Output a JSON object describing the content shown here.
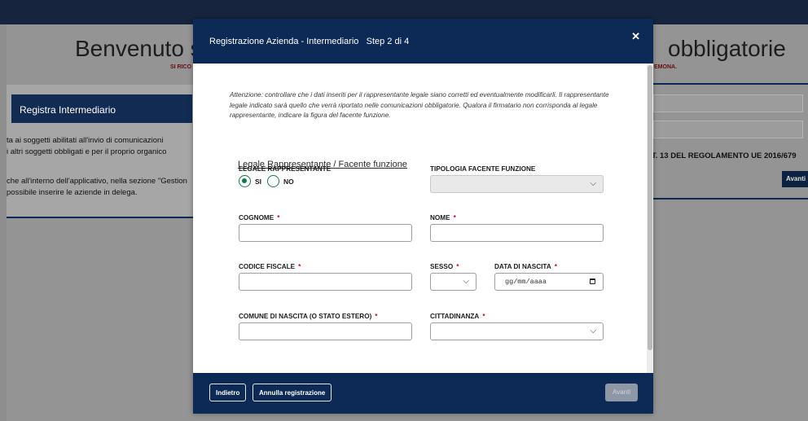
{
  "background": {
    "title_left": "Benvenuto s",
    "title_right": "obbligatorie",
    "subtitle_left": "SI RICO",
    "subtitle_right": "EMONA.",
    "card_header": "Registra Intermediario",
    "card_lines": [
      "ta ai soggetti abilitati all'invio di comunicazioni",
      "i altri soggetti obbligati e per il proprio organico",
      "",
      "che all'interno dell'applicativo, nella sezione \"Gestion",
      "possibile inserire le aziende in delega."
    ],
    "right_text": "T. 13 DEL REGOLAMENTO UE 2016/679",
    "right_button": "Avanti"
  },
  "modal": {
    "title": "Registrazione Azienda - Intermediario",
    "step": "Step 2 di 4",
    "close_icon": "close-icon",
    "warning": "Attenzione: controllare che i dati inseriti per il rappresentante legale siano corretti ed eventualmente modificarli. Il rappresentante legale indicato sarà quello che verrà riportato nelle comunicazioni obbligatorie. Qualora il firmatario non corrisponda al legale rappresentante, indicare la figura del facente funzione.",
    "section_title": "Legale Rappresentante / Facente funzione",
    "legale_label": "LEGALE RAPPRESENTANTE",
    "radio_si": "SI",
    "radio_no": "NO",
    "tipologia_label": "TIPOLOGIA FACENTE FUNZIONE",
    "cognome_label": "COGNOME",
    "nome_label": "NOME",
    "codice_label": "CODICE FISCALE",
    "sesso_label": "SESSO",
    "data_label": "DATA DI NASCITA",
    "data_placeholder": "gg/mm/aaaa",
    "comune_label": "COMUNE DI NASCITA (O STATO ESTERO)",
    "cittadinanza_label": "CITTADINANZA",
    "required_mark": "*",
    "chevron": "⌵",
    "buttons": {
      "back": "Indietro",
      "cancel": "Annulla registrazione",
      "next": "Avanti"
    }
  },
  "colors": {
    "header": "#0c2a55",
    "required": "#d0021b",
    "radio": "#0e7a4b"
  }
}
